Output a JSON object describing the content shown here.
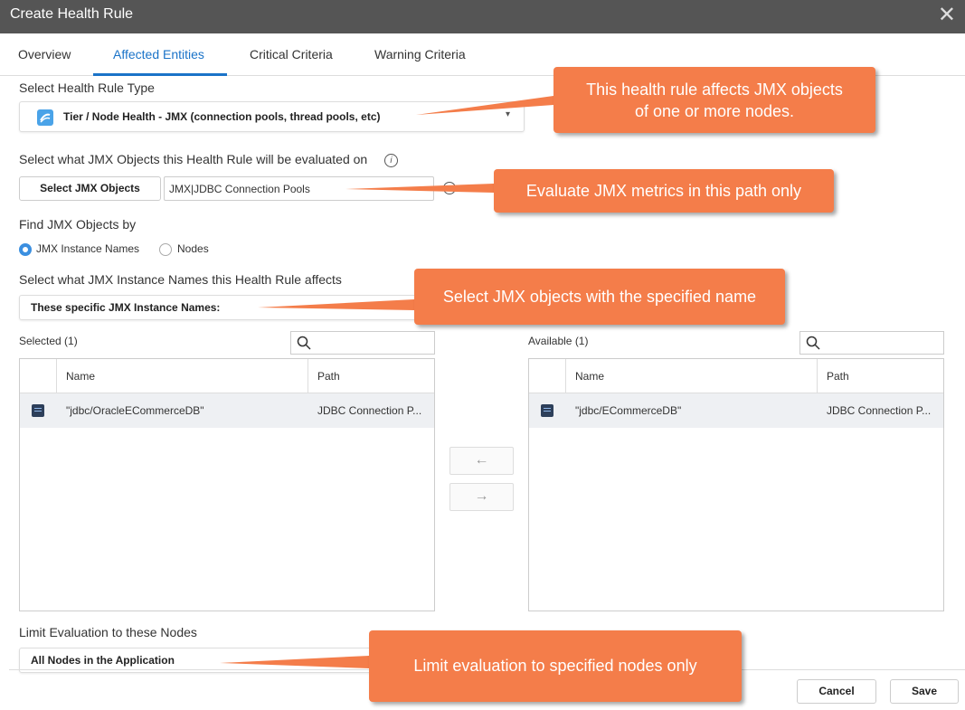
{
  "window": {
    "title": "Create Health Rule",
    "close_glyph": "✕"
  },
  "tabs": [
    {
      "label": "Overview"
    },
    {
      "label": "Affected Entities",
      "active": true
    },
    {
      "label": "Critical Criteria"
    },
    {
      "label": "Warning Criteria"
    }
  ],
  "rule_type": {
    "label": "Select Health Rule Type",
    "value": "Tier / Node Health - JMX (connection pools, thread pools, etc)"
  },
  "jmx_objects": {
    "label": "Select what JMX Objects this Health Rule will be evaluated on",
    "button": "Select JMX Objects",
    "path": "JMX|JDBC Connection Pools"
  },
  "find_by": {
    "label": "Find JMX Objects by",
    "options": [
      {
        "label": "JMX Instance Names",
        "selected": true
      },
      {
        "label": "Nodes",
        "selected": false
      }
    ]
  },
  "instance_names": {
    "label": "Select what JMX Instance Names this Health Rule affects",
    "value": "These specific JMX Instance Names:"
  },
  "selected": {
    "title": "Selected (1)",
    "columns": [
      "Name",
      "Path"
    ],
    "rows": [
      {
        "name": "\"jdbc/OracleECommerceDB\"",
        "path": "JDBC Connection P..."
      }
    ]
  },
  "available": {
    "title": "Available (1)",
    "columns": [
      "Name",
      "Path"
    ],
    "rows": [
      {
        "name": "\"jdbc/ECommerceDB\"",
        "path": "JDBC Connection P..."
      }
    ]
  },
  "transfer": {
    "left_arrow": "←",
    "right_arrow": "→"
  },
  "nodes": {
    "label": "Limit Evaluation to these Nodes",
    "value": "All Nodes in the Application"
  },
  "footer": {
    "cancel": "Cancel",
    "save": "Save"
  },
  "callouts": {
    "c1_line1": "This health rule affects JMX objects",
    "c1_line2": "of one or more nodes.",
    "c2": "Evaluate JMX metrics in this path only",
    "c3": "Select JMX objects with the specified name",
    "c4": "Limit evaluation to specified nodes only"
  },
  "colors": {
    "accent": "#1a73c8",
    "callout": "#f47d4a",
    "titlebar": "#555555"
  }
}
